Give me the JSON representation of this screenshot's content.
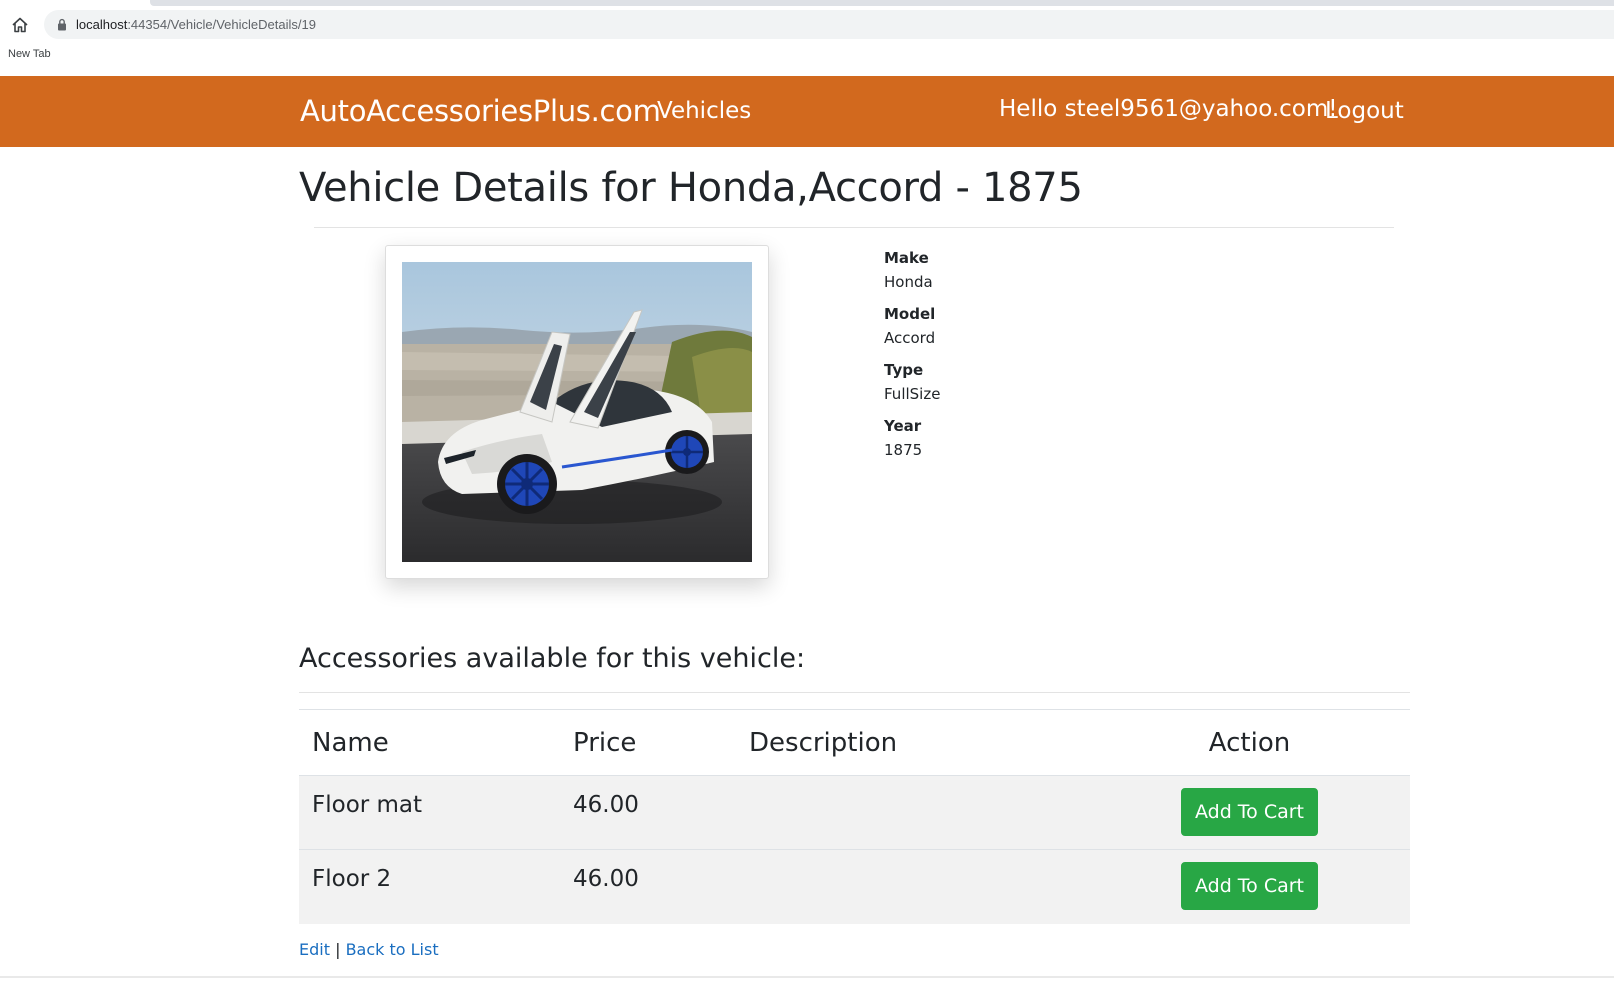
{
  "browser": {
    "url_host": "localhost",
    "url_path": ":44354/Vehicle/VehicleDetails/19",
    "bookmark": "New Tab"
  },
  "navbar": {
    "brand": "AutoAccessoriesPlus.com",
    "vehicles_link": "Vehicles",
    "greeting": "Hello steel9561@yahoo.com!",
    "logout": "Logout",
    "color": "#d2691e"
  },
  "page": {
    "title": "Vehicle Details for Honda,Accord - 1875"
  },
  "vehicle": {
    "make_label": "Make",
    "make": "Honda",
    "model_label": "Model",
    "model": "Accord",
    "type_label": "Type",
    "type": "FullSize",
    "year_label": "Year",
    "year": "1875"
  },
  "accessories": {
    "heading": "Accessories available for this vehicle:",
    "columns": [
      "Name",
      "Price",
      "Description",
      "Action"
    ],
    "rows": [
      {
        "name": "Floor mat",
        "price": "46.00",
        "description": "",
        "action": "Add To Cart"
      },
      {
        "name": "Floor 2",
        "price": "46.00",
        "description": "",
        "action": "Add To Cart"
      }
    ]
  },
  "footer": {
    "edit": "Edit",
    "separator": "|",
    "back": "Back to List"
  }
}
